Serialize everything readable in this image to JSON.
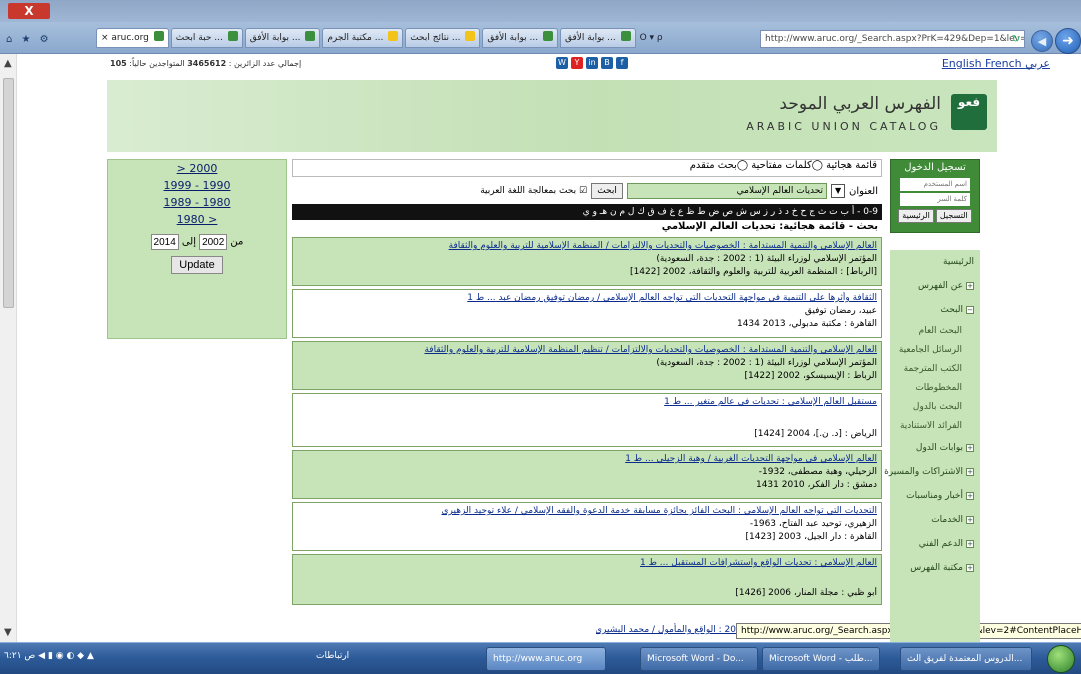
{
  "browser": {
    "close_label": "X",
    "address": "http://www.aruc.org/_Search.aspx?PrK=429&Dep=1&lev=2",
    "address_domain": "aruc.org",
    "page_search": "O ▾ ρ",
    "tabs": [
      {
        "label": "aruc.org",
        "active": true
      },
      {
        "label": "حبة ابحث ..."
      },
      {
        "label": "بوابة الأفق ..."
      },
      {
        "label": "مكتبة الجرم ..."
      },
      {
        "label": "نتائج ابحث ..."
      },
      {
        "label": "بوابة الأفق ..."
      },
      {
        "label": "بوابة الأفق ..."
      }
    ]
  },
  "header": {
    "visitors_label": "إجمالي عدد الزائرين : ",
    "visitors_total": "3465612",
    "online_label": " المتواجدين حالياً: ",
    "online_count": "105",
    "langs": "English French عربي",
    "social": [
      "W",
      "Y",
      "in",
      "B",
      "f"
    ]
  },
  "banner": {
    "logo_mark": "ﻓﻌﻮ",
    "title_ar": "الفهرس العربي الموحد",
    "title_en": "ARABIC UNION CATALOG"
  },
  "date_filter": {
    "links": [
      "> 2000",
      "1999 - 1990",
      "1989 - 1980",
      "1980 >"
    ],
    "from_label": "من",
    "from_value": "2002",
    "to_label": "إلى",
    "to_value": "2014",
    "update_label": "Update"
  },
  "search": {
    "radio_options": "قائمة هجائية ◯كلمات مفتاحية ◯بحث متقدم",
    "field_label": "العنوان",
    "query": "تحديات العالم الإسلامي",
    "search_button": "ابحث",
    "arabic_check": "☑ بحث بمعالجة اللغة العربية",
    "alphabet": "0-9 - أ ب ت ث ج ح خ د ذ ر ز س ش ص ض ط ظ ع غ ف ق ك ل م ن هـ و ي",
    "results_heading": "بحث - قائمة هجائية: تحديات العالم الإسلامي"
  },
  "results": [
    {
      "title": "العالم الإسلامي والتنمية المستدامة : الخصوصيات والتحديات والالتزامات / المنظمة الإسلامية للتربية والعلوم والثقافة",
      "lines": [
        "المؤتمر الإسلامي لوزراء البيئة (1 : 2002 : جدة، السعودية)",
        "[الرباط] : المنظمة العربية للتربية والعلوم والثقافة، 2002 [1422]"
      ]
    },
    {
      "title": "الثقافة وأثرها على التنمية في مواجهة التحديات التي تواجه العالم الإسلامي / رمضان توفيق رمضان عبد ... ط 1",
      "lines": [
        "عبيد، رمضان توفيق",
        "القاهرة : مكتبة مدبولي، 2013 1434"
      ]
    },
    {
      "title": "العالم الإسلامي والتنمية المستدامة : الخصوصيات والتحديات والالتزامات / تنظيم المنظمة الإسلامية للتربية والعلوم والثقافة",
      "lines": [
        "المؤتمر الإسلامي لوزراء البيئة (1 : 2002 : جدة، السعودية)",
        "الرباط : الإيسيسكو، 2002 [1422]"
      ]
    },
    {
      "title": "مستقبل العالم الإسلامي : تحديات في عالم متغير ... ط 1",
      "lines": [
        "",
        "الرياض : [د. ن.]، 2004 [1424]"
      ]
    },
    {
      "title": "العالم الإسلامي في مواجهة التحديات الغربية / وهبة الزحيلي ... ط 1",
      "lines": [
        "الزحيلي، وهبة مصطفى، 1932-",
        "دمشق : دار الفكر، 2010 1431"
      ]
    },
    {
      "title": "التحديات التي تواجه العالم الإسلامي : البحث الفائز بجائزة مسابقة خدمة الدعوة والفقه الإسلامي / علاء توحيد الزهيري",
      "lines": [
        "الزهيري، توحيد عبد الفتاح، 1963-",
        "القاهرة : دار الجيل، 2003 [1423]"
      ]
    },
    {
      "title": "العالم الإسلامي : تحديات الواقع واستشرافات المستقبل ... ط 1",
      "lines": [
        "",
        "أبو ظبي : مجلة المنار، 2006 [1426]"
      ]
    },
    {
      "title": "20 : الواقع والمأمول / محمد البشيري",
      "lines": []
    }
  ],
  "tooltip_url": "http://www.aruc.org/_Search.aspx?PrK=429&Dep=1&lev=2#ContentPlaceHolder1",
  "login": {
    "title": "تسجيل الدخول",
    "username_placeholder": "اسم المستخدم",
    "password_placeholder": "كلمة السر",
    "buttons": [
      "الرئيسية",
      "التسجيل"
    ]
  },
  "sidebar": {
    "items": [
      {
        "label": "الرئيسية",
        "type": "item"
      },
      {
        "label": "عن الفهرس",
        "type": "plus"
      },
      {
        "label": "البحث",
        "type": "minus"
      },
      {
        "label": "البحث العام",
        "type": "sub"
      },
      {
        "label": "الرسائل الجامعية",
        "type": "sub"
      },
      {
        "label": "الكتب المترجمة",
        "type": "sub"
      },
      {
        "label": "المخطوطات",
        "type": "sub"
      },
      {
        "label": "البحث بالدول",
        "type": "sub"
      },
      {
        "label": "الفرائد الاستنادية",
        "type": "sub"
      },
      {
        "label": "بوابات الدول",
        "type": "plus"
      },
      {
        "label": "الاشتراكات والمسيرة",
        "type": "plus"
      },
      {
        "label": "أخبار ومناسبات",
        "type": "plus"
      },
      {
        "label": "الخدمات",
        "type": "plus"
      },
      {
        "label": "الدعم الفني",
        "type": "plus"
      },
      {
        "label": "مكتبة الفهرس",
        "type": "plus"
      }
    ]
  },
  "taskbar": {
    "tray": "ﺹ ٦:٢١",
    "tray_lang": "ارتباطات",
    "tasks": [
      {
        "label": "http://www.aruc.org",
        "active": true
      },
      {
        "label": "Microsoft Word - Do..."
      },
      {
        "label": "Microsoft Word - ﻃﻠﺐ..."
      },
      {
        "label": "الدروس المعتمدة لفريق الث..."
      }
    ]
  }
}
